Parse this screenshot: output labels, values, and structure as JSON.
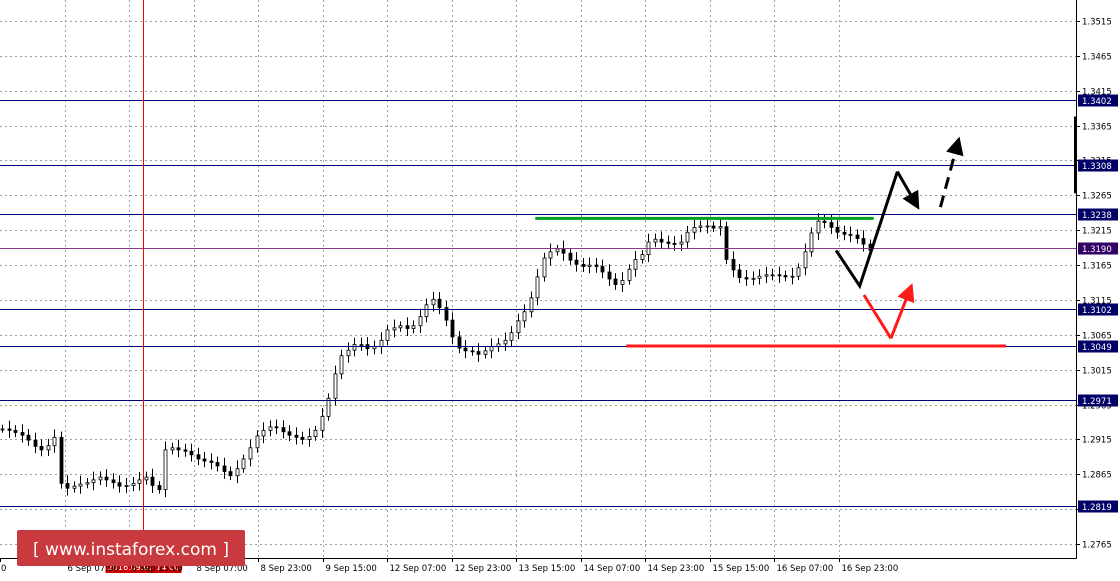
{
  "chart_data": {
    "type": "candlestick",
    "ylim": [
      1.2745,
      1.3545
    ],
    "y_ticks": [
      "1.2765",
      "1.2815",
      "1.2865",
      "1.2915",
      "1.2965",
      "1.3015",
      "1.3065",
      "1.3115",
      "1.3165",
      "1.3215",
      "1.3265",
      "1.3315",
      "1.3365",
      "1.3415",
      "1.3465",
      "1.3515"
    ],
    "x_labels": [
      "0",
      "6 Sep 07:00",
      "6 Sep 23:00",
      "8 Sep 07:00",
      "8 Sep 23:00",
      "9 Sep 15:00",
      "12 Sep 07:00",
      "12 Sep 23:00",
      "13 Sep 15:00",
      "14 Sep 07:00",
      "14 Sep 23:00",
      "15 Sep 15:00",
      "16 Sep 07:00",
      "16 Sep 23:00"
    ],
    "levels": [
      {
        "value": 1.3402,
        "label": "1.3402",
        "bg": "#000066"
      },
      {
        "value": 1.3308,
        "label": "1.3308",
        "bg": "#000066"
      },
      {
        "value": 1.3238,
        "label": "1.3238",
        "bg": "#000066"
      },
      {
        "value": 1.319,
        "label": "1.3190",
        "bg": "#330066"
      },
      {
        "value": 1.3102,
        "label": "1.3102",
        "bg": "#000066"
      },
      {
        "value": 1.3049,
        "label": "1.3049",
        "bg": "#000066"
      },
      {
        "value": 1.2971,
        "label": "1.2971",
        "bg": "#000066"
      },
      {
        "value": 1.2819,
        "label": "1.2819",
        "bg": "#000066"
      }
    ],
    "cursor_date": "2016.09.07 14:00",
    "candle_closes": [
      1.293,
      1.2928,
      1.2925,
      1.2921,
      1.2914,
      1.2905,
      1.29,
      1.2906,
      1.2918,
      1.2852,
      1.2845,
      1.2848,
      1.2851,
      1.2853,
      1.2857,
      1.2861,
      1.2857,
      1.2853,
      1.2848,
      1.2849,
      1.2852,
      1.2857,
      1.2861,
      1.2849,
      1.2843,
      1.29,
      1.2903,
      1.29,
      1.2898,
      1.2893,
      1.2887,
      1.2884,
      1.2882,
      1.2877,
      1.2869,
      1.2863,
      1.2873,
      1.2887,
      1.2903,
      1.292,
      1.2928,
      1.2933,
      1.2932,
      1.2926,
      1.2921,
      1.2918,
      1.2915,
      1.2919,
      1.2928,
      1.2948,
      1.2974,
      1.3009,
      1.3035,
      1.3043,
      1.3051,
      1.3051,
      1.3045,
      1.3048,
      1.3057,
      1.3072,
      1.3075,
      1.3078,
      1.3074,
      1.3078,
      1.3091,
      1.3108,
      1.3116,
      1.3104,
      1.3086,
      1.3062,
      1.3046,
      1.3042,
      1.3041,
      1.3037,
      1.3042,
      1.3048,
      1.3052,
      1.3057,
      1.3068,
      1.3085,
      1.3098,
      1.3118,
      1.3148,
      1.3175,
      1.3184,
      1.3188,
      1.3182,
      1.3172,
      1.3166,
      1.3163,
      1.3165,
      1.3163,
      1.3155,
      1.3145,
      1.3137,
      1.3143,
      1.3159,
      1.3173,
      1.318,
      1.3198,
      1.3202,
      1.3198,
      1.3196,
      1.3195,
      1.3198,
      1.3212,
      1.3219,
      1.3221,
      1.3221,
      1.3218,
      1.322,
      1.3173,
      1.3158,
      1.3147,
      1.3145,
      1.3146,
      1.3149,
      1.3151,
      1.3151,
      1.315,
      1.3148,
      1.3149,
      1.3161,
      1.3184,
      1.3211,
      1.3228,
      1.3226,
      1.3219,
      1.3212,
      1.3209,
      1.3208,
      1.3203,
      1.3195,
      1.3186
    ],
    "annotations": {
      "resistance_line": {
        "color": "#00a020",
        "from": [
          0.4975,
          1.3232
        ],
        "to": [
          0.812,
          1.3232
        ]
      },
      "support_line": {
        "color": "#ff1a1a",
        "from": [
          0.582,
          1.3049
        ],
        "to": [
          0.935,
          1.3049
        ]
      },
      "scenario_up_path": {
        "color": "#000000",
        "points": [
          [
            0.777,
            1.3186
          ],
          [
            0.799,
            1.3135
          ],
          [
            0.834,
            1.3299
          ]
        ]
      },
      "scenario_up_arrow": {
        "color": "#000000",
        "from": [
          0.834,
          1.3299
        ],
        "to": [
          0.853,
          1.3248
        ]
      },
      "scenario_up_dashed_arrow": {
        "color": "#000000",
        "from": [
          0.874,
          1.3248
        ],
        "to": [
          0.891,
          1.3345
        ]
      },
      "scenario_down_path": {
        "color": "#ff1a1a",
        "points": [
          [
            0.803,
            1.3122
          ],
          [
            0.828,
            1.306
          ]
        ]
      },
      "scenario_down_arrow": {
        "color": "#ff1a1a",
        "from": [
          0.828,
          1.306
        ],
        "to": [
          0.847,
          1.3135
        ]
      }
    }
  },
  "watermark": {
    "text": "[ www.instaforex.com ]",
    "bg": "#c93a3f"
  }
}
